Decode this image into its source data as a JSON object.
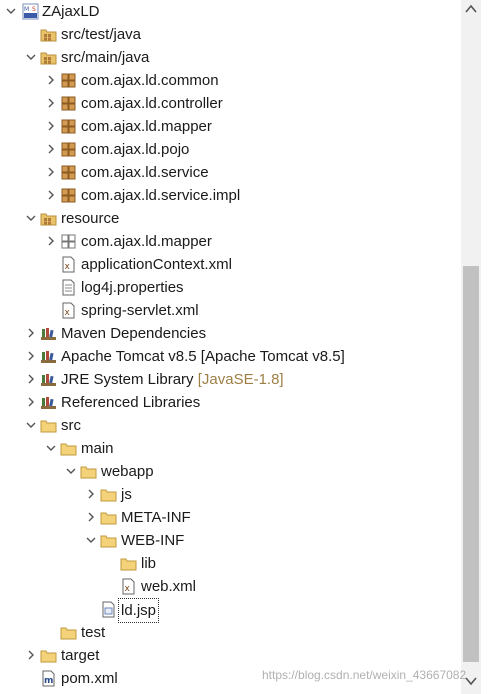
{
  "tree": {
    "items": [
      {
        "label": "ZAjaxLD",
        "icon": "maven-project-icon",
        "expand": "expanded"
      },
      {
        "label": "src/test/java",
        "icon": "source-folder-icon",
        "expand": "none"
      },
      {
        "label": "src/main/java",
        "icon": "source-folder-icon",
        "expand": "expanded"
      },
      {
        "label": "com.ajax.ld.common",
        "icon": "package-icon",
        "expand": "collapsed"
      },
      {
        "label": "com.ajax.ld.controller",
        "icon": "package-icon",
        "expand": "collapsed"
      },
      {
        "label": "com.ajax.ld.mapper",
        "icon": "package-icon",
        "expand": "collapsed"
      },
      {
        "label": "com.ajax.ld.pojo",
        "icon": "package-icon",
        "expand": "collapsed"
      },
      {
        "label": "com.ajax.ld.service",
        "icon": "package-icon",
        "expand": "collapsed"
      },
      {
        "label": "com.ajax.ld.service.impl",
        "icon": "package-icon",
        "expand": "collapsed"
      },
      {
        "label": "resource",
        "icon": "source-folder-icon",
        "expand": "expanded"
      },
      {
        "label": "com.ajax.ld.mapper",
        "icon": "empty-package-icon",
        "expand": "collapsed"
      },
      {
        "label": "applicationContext.xml",
        "icon": "xml-file-icon",
        "expand": "none"
      },
      {
        "label": "log4j.properties",
        "icon": "text-file-icon",
        "expand": "none"
      },
      {
        "label": "spring-servlet.xml",
        "icon": "xml-file-icon",
        "expand": "none"
      },
      {
        "label": "Maven Dependencies",
        "icon": "library-icon",
        "expand": "collapsed"
      },
      {
        "label": "Apache Tomcat v8.5 [Apache Tomcat v8.5]",
        "icon": "library-icon",
        "expand": "collapsed"
      },
      {
        "label": "JRE System Library",
        "decoration": "[JavaSE-1.8]",
        "icon": "library-icon",
        "expand": "collapsed"
      },
      {
        "label": "Referenced Libraries",
        "icon": "library-icon",
        "expand": "collapsed"
      },
      {
        "label": "src",
        "icon": "folder-icon",
        "expand": "expanded"
      },
      {
        "label": "main",
        "icon": "folder-icon",
        "expand": "expanded"
      },
      {
        "label": "webapp",
        "icon": "folder-icon",
        "expand": "expanded"
      },
      {
        "label": "js",
        "icon": "folder-icon",
        "expand": "collapsed"
      },
      {
        "label": "META-INF",
        "icon": "folder-icon",
        "expand": "collapsed"
      },
      {
        "label": "WEB-INF",
        "icon": "folder-icon",
        "expand": "expanded"
      },
      {
        "label": "lib",
        "icon": "folder-icon",
        "expand": "none"
      },
      {
        "label": "web.xml",
        "icon": "xml-file-icon",
        "expand": "none"
      },
      {
        "label": "ld.jsp",
        "icon": "jsp-file-icon",
        "expand": "none",
        "selected": true
      },
      {
        "label": "test",
        "icon": "folder-icon",
        "expand": "none"
      },
      {
        "label": "target",
        "icon": "folder-icon",
        "expand": "collapsed"
      },
      {
        "label": "pom.xml",
        "icon": "maven-pom-icon",
        "expand": "none"
      }
    ]
  },
  "watermark": "https://blog.csdn.net/weixin_43667082",
  "colors": {
    "background": "#ffffff",
    "text": "#1a1a1a",
    "decoration": "#9e8046",
    "folder": "#e8c36a",
    "package": "#b07a3a",
    "scroll_thumb": "#c1c1c1"
  }
}
